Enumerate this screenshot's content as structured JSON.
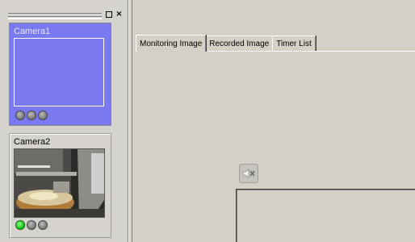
{
  "sidebar": {
    "window_buttons": {
      "restore": "□",
      "close": "×"
    },
    "cameras": [
      {
        "title": "Camera1",
        "status_dots": [
          "gray",
          "gray",
          "gray"
        ]
      },
      {
        "title": "Camera2",
        "status_dots": [
          "green",
          "gray",
          "gray"
        ]
      }
    ]
  },
  "main": {
    "tabs": [
      {
        "label": "Monitoring Image"
      },
      {
        "label": "Recorded Image"
      },
      {
        "label": "Timer List"
      }
    ],
    "mute_icon": "speaker-mute-icon"
  },
  "colors": {
    "selected_camera_bg": "#7b79f0",
    "status_active": "#12c412",
    "status_idle": "#777777",
    "window_bg": "#d5d0c6"
  }
}
